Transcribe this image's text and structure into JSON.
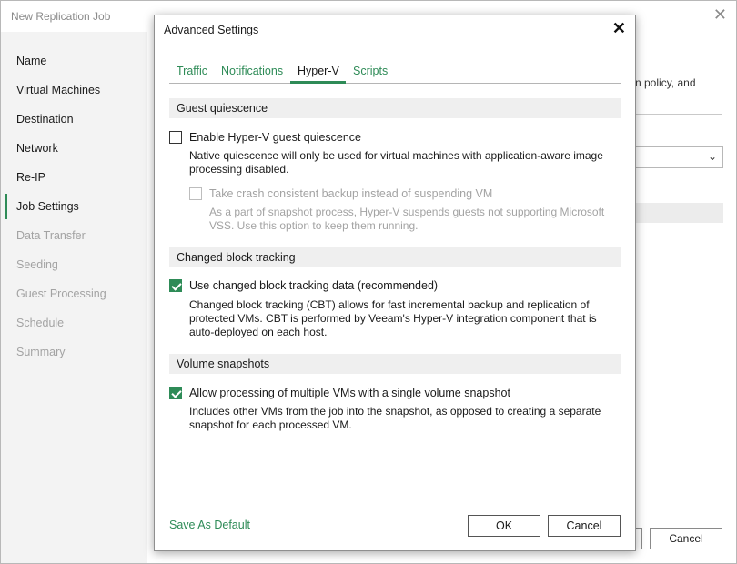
{
  "window": {
    "title": "New Replication Job",
    "cancel_label": "Cancel"
  },
  "sidebar": {
    "items": [
      {
        "label": "Name"
      },
      {
        "label": "Virtual Machines"
      },
      {
        "label": "Destination"
      },
      {
        "label": "Network"
      },
      {
        "label": "Re-IP"
      },
      {
        "label": "Job Settings"
      },
      {
        "label": "Data Transfer"
      },
      {
        "label": "Seeding"
      },
      {
        "label": "Guest Processing"
      },
      {
        "label": "Schedule"
      },
      {
        "label": "Summary"
      }
    ]
  },
  "background": {
    "partial_text": "n policy, and"
  },
  "dialog": {
    "title": "Advanced Settings",
    "tabs": [
      {
        "label": "Traffic"
      },
      {
        "label": "Notifications"
      },
      {
        "label": "Hyper-V"
      },
      {
        "label": "Scripts"
      }
    ],
    "active_tab": "Hyper-V",
    "guest_quiescence": {
      "heading": "Guest quiescence",
      "enable_label": "Enable Hyper-V guest quiescence",
      "enable_checked": false,
      "enable_desc_1": "Native quiescence will only be used for virtual machines with application-aware image",
      "enable_desc_2": "processing disabled.",
      "crash_label": "Take crash consistent backup instead of suspending VM",
      "crash_checked": false,
      "crash_desc_1": "As a part of snapshot process, Hyper-V suspends guests not supporting Microsoft",
      "crash_desc_2": "VSS. Use this option to keep them running."
    },
    "cbt": {
      "heading": "Changed block tracking",
      "label": "Use changed block tracking data (recommended)",
      "checked": true,
      "desc_1": "Changed block tracking (CBT) allows for fast incremental backup and replication of",
      "desc_2": "protected VMs. CBT is performed by Veeam's Hyper-V integration component that is",
      "desc_3": "auto-deployed on each host."
    },
    "volume": {
      "heading": "Volume snapshots",
      "label": "Allow processing of multiple VMs with a single volume snapshot",
      "checked": true,
      "desc_1": "Includes other VMs from the job into the snapshot, as opposed to creating a separate",
      "desc_2": "snapshot for each processed VM."
    },
    "save_default_label": "Save As Default",
    "ok_label": "OK",
    "cancel_label": "Cancel"
  },
  "colors": {
    "accent": "#2e8b57"
  }
}
